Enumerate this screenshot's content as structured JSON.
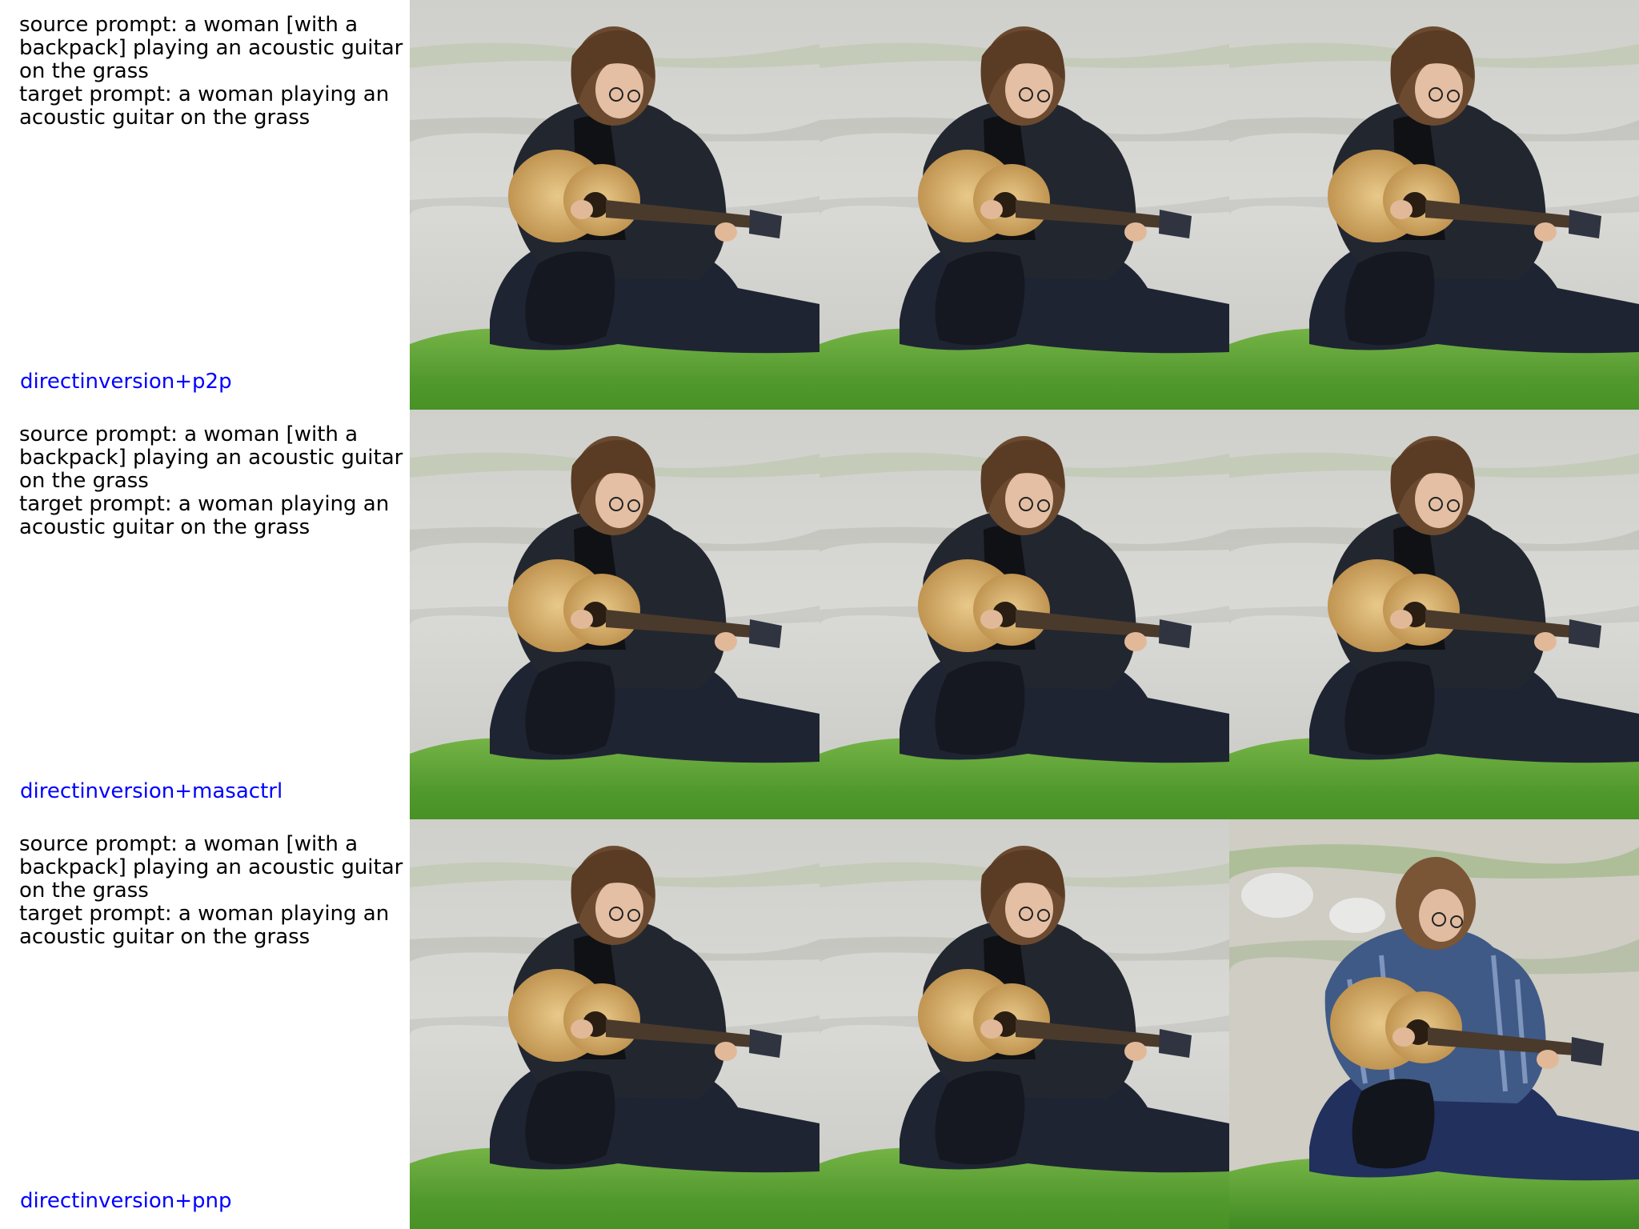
{
  "rows": [
    {
      "source_prompt": "source prompt: a woman [with a backpack] playing an acoustic guitar on the grass",
      "target_prompt": "target prompt: a woman playing an acoustic guitar on the grass",
      "method": "directinversion+p2p"
    },
    {
      "source_prompt": "source prompt: a woman [with a backpack] playing an acoustic guitar on the grass",
      "target_prompt": "target prompt: a woman playing an acoustic guitar on the grass",
      "method": "directinversion+masactrl"
    },
    {
      "source_prompt": "source prompt: a woman [with a backpack] playing an acoustic guitar on the grass",
      "target_prompt": "target prompt: a woman playing an acoustic guitar on the grass",
      "method": "directinversion+pnp"
    }
  ],
  "colors": {
    "method_label": "#0000ff",
    "prompt_text": "#000000"
  }
}
